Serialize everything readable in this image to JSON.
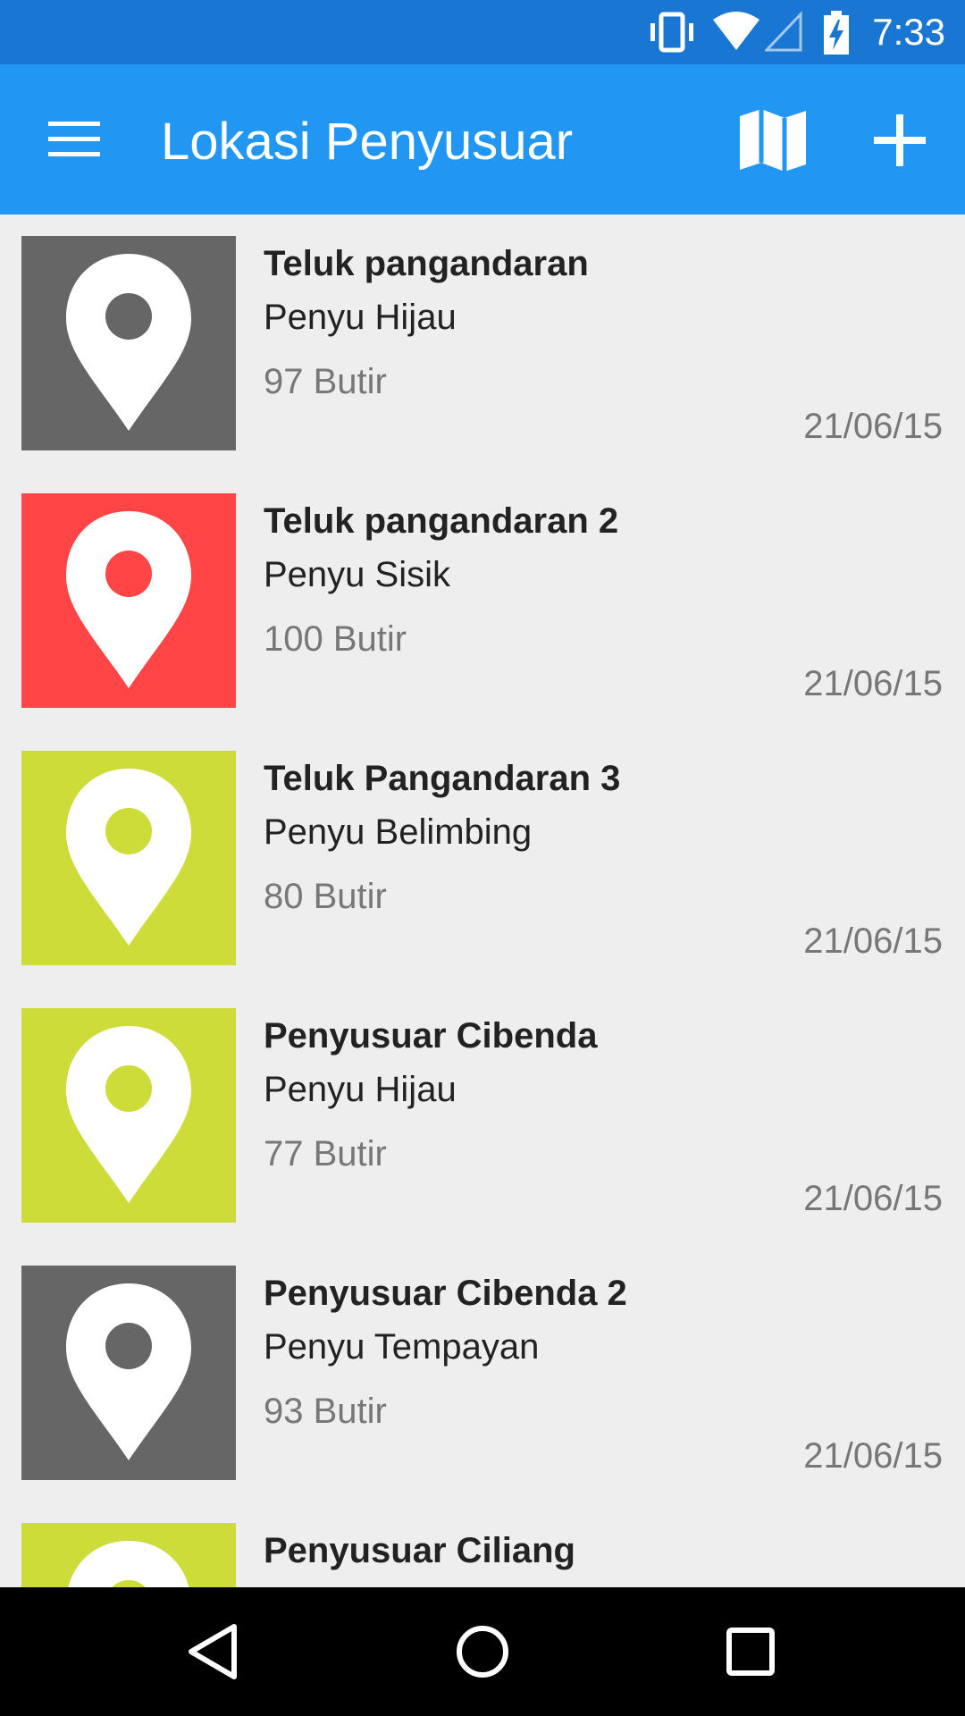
{
  "status_bar": {
    "time": "7:33",
    "icons": [
      "vibrate-icon",
      "wifi-icon",
      "cell-signal-icon",
      "battery-charging-icon"
    ]
  },
  "app_bar": {
    "title": "Lokasi Penyusuar",
    "color": "#2196f3",
    "status_color": "#1976d2",
    "icons": [
      "menu-icon",
      "map-icon",
      "add-icon"
    ]
  },
  "pin_colors": {
    "gray": "#666666",
    "red": "#ff4545",
    "lime": "#cddc39"
  },
  "items": [
    {
      "name": "Teluk pangandaran",
      "species": "Penyu Hijau",
      "count": "97 Butir",
      "date": "21/06/15",
      "color": "gray"
    },
    {
      "name": "Teluk pangandaran 2",
      "species": "Penyu Sisik",
      "count": "100 Butir",
      "date": "21/06/15",
      "color": "red"
    },
    {
      "name": "Teluk Pangandaran 3",
      "species": "Penyu Belimbing",
      "count": "80 Butir",
      "date": "21/06/15",
      "color": "lime"
    },
    {
      "name": "Penyusuar Cibenda",
      "species": "Penyu Hijau",
      "count": "77 Butir",
      "date": "21/06/15",
      "color": "lime"
    },
    {
      "name": "Penyusuar Cibenda 2",
      "species": "Penyu Tempayan",
      "count": "93 Butir",
      "date": "21/06/15",
      "color": "gray"
    },
    {
      "name": "Penyusuar Ciliang",
      "species": "",
      "count": "",
      "date": "",
      "color": "lime"
    }
  ],
  "nav_bar": {
    "icons": [
      "back-icon",
      "home-icon",
      "recents-icon"
    ]
  }
}
